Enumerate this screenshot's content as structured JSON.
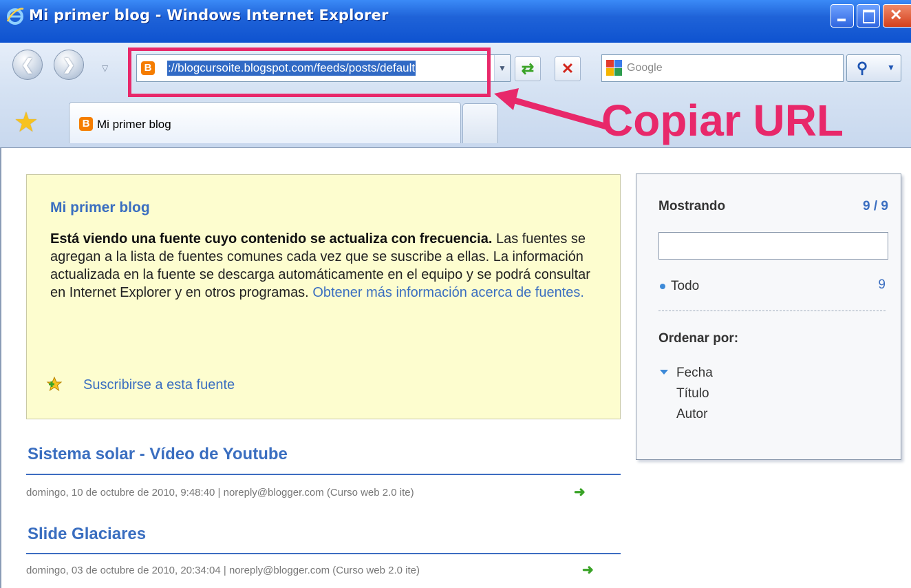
{
  "window": {
    "title": "Mi primer blog - Windows Internet Explorer"
  },
  "toolbar": {
    "address_url": "://blogcursoite.blogspot.com/feeds/posts/default",
    "search_placeholder": "Google"
  },
  "tabs": [
    {
      "label": "Mi primer blog"
    }
  ],
  "annotation": {
    "label": "Copiar URL",
    "color": "#e8286a"
  },
  "feed": {
    "title": "Mi primer blog",
    "bold_intro": "Está viendo una fuente cuyo contenido se actualiza con frecuencia.",
    "body": " Las fuentes se agregan a la lista de fuentes comunes cada vez que se suscribe a ellas. La información actualizada en la fuente se descarga automáticamente en el equipo y se podrá consultar en Internet Explorer y en otros programas. ",
    "more_link": "Obtener más información acerca de fuentes.",
    "subscribe_link": "Suscribirse a esta fuente"
  },
  "posts": [
    {
      "title": "Sistema solar - Vídeo de Youtube",
      "meta": "domingo, 10 de octubre de 2010, 9:48:40 | noreply@blogger.com (Curso web 2.0 ite)"
    },
    {
      "title": "Slide Glaciares",
      "meta": "domingo, 03 de octubre de 2010, 20:34:04 | noreply@blogger.com (Curso web 2.0 ite)"
    }
  ],
  "sidebar": {
    "showing_label": "Mostrando",
    "showing_count": "9 / 9",
    "filter_all_label": "Todo",
    "filter_all_count": "9",
    "sort_heading": "Ordenar por:",
    "sort_options": [
      "Fecha",
      "Título",
      "Autor"
    ]
  },
  "colors": {
    "link_blue": "#3a6ec0",
    "infobox_bg": "#fdfdcf",
    "title_bar": "#0b4fce"
  }
}
